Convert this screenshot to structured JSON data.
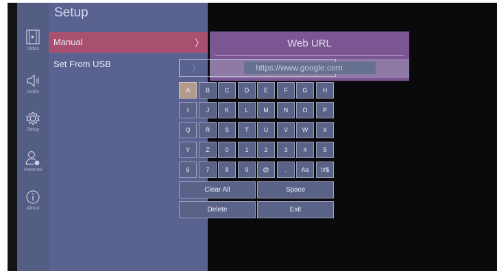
{
  "sidebar": {
    "items": [
      {
        "label": "Video",
        "icon": "video-icon"
      },
      {
        "label": "Audio",
        "icon": "speaker-icon"
      },
      {
        "label": "Setup",
        "icon": "gear-icon"
      },
      {
        "label": "Parental",
        "icon": "parental-icon"
      },
      {
        "label": "About",
        "icon": "info-icon"
      }
    ]
  },
  "setup": {
    "title": "Setup",
    "items": [
      {
        "label": "Manual",
        "chevron": "〉"
      },
      {
        "label": "Set From USB",
        "chevron": "〉"
      }
    ]
  },
  "url_dialog": {
    "title": "Web URL",
    "value": "https://www.google.com",
    "chevron": "〉"
  },
  "keyboard": {
    "rows": [
      [
        "A",
        "B",
        "C",
        "D",
        "E",
        "F",
        "G",
        "H"
      ],
      [
        "I",
        "J",
        "K",
        "L",
        "M",
        "N",
        "O",
        "P"
      ],
      [
        "Q",
        "R",
        "S",
        "T",
        "U",
        "V",
        "W",
        "X"
      ],
      [
        "Y",
        "Z",
        "0",
        "1",
        "2",
        "3",
        "4",
        "5"
      ],
      [
        "6",
        "7",
        "8",
        "9",
        "@",
        ".",
        "Aa",
        "!#$"
      ]
    ],
    "clear_all": "Clear All",
    "space": "Space",
    "delete": "Delete",
    "exit": "Exit"
  },
  "colors": {
    "selected_menu": "#a8506f",
    "dialog": "#7a5793",
    "active_key": "#b49a8c"
  }
}
